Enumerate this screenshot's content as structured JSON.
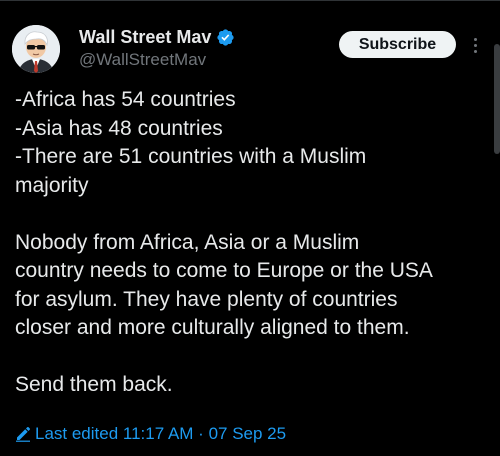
{
  "post": {
    "author": {
      "display_name": "Wall Street Mav",
      "handle": "@WallStreetMav",
      "verified": true,
      "avatar_icon": "cartoon-man-sunglasses-avatar"
    },
    "subscribe_label": "Subscribe",
    "more_icon": "more-vertical-icon",
    "body_lines": [
      "-Africa has 54 countries",
      "-Asia has 48 countries",
      "-There are 51 countries with a Muslim",
      "majority",
      "Nobody from Africa, Asia or a Muslim",
      "country needs to come to Europe or the USA",
      "for asylum. They have plenty of countries",
      "closer and more culturally aligned to them.",
      "Send them back."
    ],
    "edited_label": "Last edited 11:17 AM · 07 Sep 25",
    "edit_icon": "pencil-icon"
  },
  "colors": {
    "background": "#000000",
    "text": "#e7e9ea",
    "muted": "#71767b",
    "accent": "#1d9bf0",
    "button_bg": "#eff3f4"
  }
}
